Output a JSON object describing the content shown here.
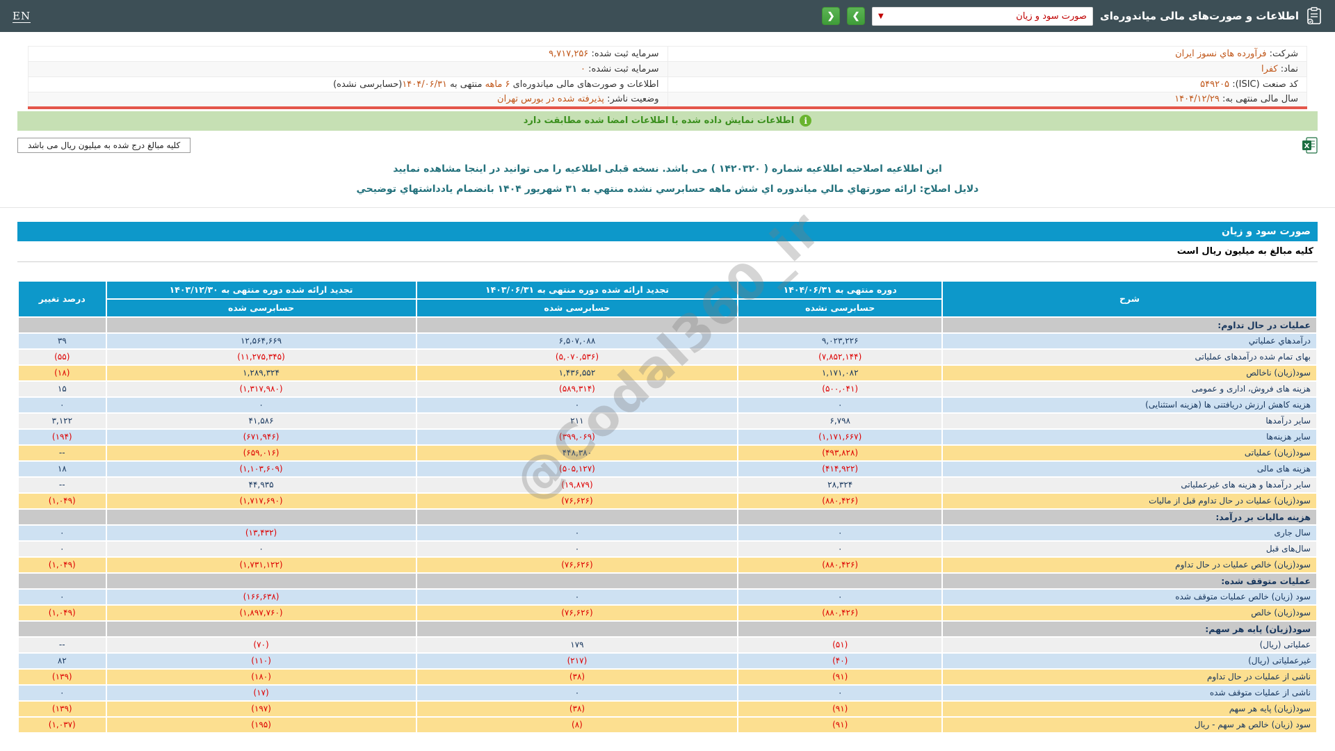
{
  "topbar": {
    "title": "اطلاعات و صورت‌های مالی میاندوره‌ای",
    "dropdown_value": "صورت سود و زیان",
    "dropdown_chevron": "▼",
    "next_label": "❯",
    "prev_label": "❮",
    "lang_link": "EN"
  },
  "company": {
    "name_label": "شرکت:",
    "name_value": "فرآورده هاي نسوز ايران",
    "cap_reg_label": "سرمایه ثبت شده:",
    "cap_reg_value": "۹,۷۱۷,۲۵۶",
    "symbol_label": "نماد:",
    "symbol_value": "کفرا",
    "cap_unreg_label": "سرمایه ثبت نشده:",
    "cap_unreg_value": "۰",
    "isic_label": "کد صنعت (ISIC):",
    "isic_value": "۵۴۹۲۰۵",
    "period_text1": "اطلاعات و صورت‌های مالی میاندوره‌ای ",
    "period_hl1": "۶ ماهه",
    "period_text2": " منتهی به ",
    "period_hl2": "۱۴۰۴/۰۶/۳۱",
    "period_text3": "(حسابرسی نشده)",
    "fiscal_label": "سال مالی منتهی به:",
    "fiscal_value": "۱۴۰۴/۱۲/۲۹",
    "status_label": "وضعیت ناشر:",
    "status_value": "پذیرفته شده در بورس تهران"
  },
  "banner": {
    "text": "اطلاعات نمایش داده شده با اطلاعات امضا شده مطابقت دارد",
    "icon_glyph": "i"
  },
  "units": {
    "boxed_note": "کلیه مبالغ درج شده به میلیون ریال می باشد",
    "table_note": "کلیه مبالغ به میلیون ریال است"
  },
  "notices": {
    "amendment": "این اطلاعیه اصلاحیه اطلاعیه شماره ( ۱۴۲۰۳۲۰ ) می باشد. نسخه قبلی اطلاعیه را می توانید در اینجا مشاهده نمایید",
    "reason": "دلایل اصلاح: ارائه صورتهاي مالي میاندوره اي شش ماهه حسابرسي نشده منتهي به ۳۱ شهریور ۱۴۰۴ بانضمام یادداشتهاي توضیحي"
  },
  "statement": {
    "title": "صورت سود و زیان"
  },
  "watermark": {
    "text": "@Codal360_ir"
  },
  "table": {
    "columns": [
      {
        "title": "شرح",
        "sub": null
      },
      {
        "title": "دوره منتهی به ۱۴۰۴/۰۶/۳۱",
        "sub": "حسابرسی نشده"
      },
      {
        "title": "تجدید ارائه شده دوره منتهی به ۱۴۰۳/۰۶/۳۱",
        "sub": "حسابرسی شده"
      },
      {
        "title": "تجدید ارائه شده دوره منتهی به ۱۴۰۳/۱۲/۳۰",
        "sub": "حسابرسی شده"
      },
      {
        "title": "درصد تغییر",
        "sub": null
      }
    ],
    "col_widths": [
      "28.9%",
      "15.7%",
      "24.8%",
      "23.9%",
      "6.7%"
    ],
    "rows": [
      {
        "type": "section",
        "label": "عملیات در حال تداوم:",
        "v1": "",
        "v2": "",
        "v3": "",
        "pct": ""
      },
      {
        "type": "blue",
        "label": "درآمدهاي عملياتي",
        "v1": "۹,۰۲۳,۲۲۶",
        "v2": "۶,۵۰۷,۰۸۸",
        "v3": "۱۲,۵۶۴,۶۶۹",
        "pct": "۳۹"
      },
      {
        "type": "gray",
        "label": "بهای تمام شده درآمدهای عملیاتی",
        "v1": "(۷,۸۵۲,۱۴۴)",
        "v2": "(۵,۰۷۰,۵۳۶)",
        "v3": "(۱۱,۲۷۵,۳۴۵)",
        "pct": "(۵۵)"
      },
      {
        "type": "yellow",
        "label": "سود(زیان) ناخالص",
        "v1": "۱,۱۷۱,۰۸۲",
        "v2": "۱,۴۳۶,۵۵۲",
        "v3": "۱,۲۸۹,۳۲۴",
        "pct": "(۱۸)"
      },
      {
        "type": "gray",
        "label": "هزینه های فروش، اداری و عمومی",
        "v1": "(۵۰۰,۰۴۱)",
        "v2": "(۵۸۹,۳۱۴)",
        "v3": "(۱,۳۱۷,۹۸۰)",
        "pct": "۱۵"
      },
      {
        "type": "blue",
        "label": "هزینه کاهش ارزش دریافتنی ها (هزینه استثنایی)",
        "v1": "۰",
        "v2": "۰",
        "v3": "۰",
        "pct": "۰"
      },
      {
        "type": "gray",
        "label": "سایر درآمدها",
        "v1": "۶,۷۹۸",
        "v2": "۲۱۱",
        "v3": "۴۱,۵۸۶",
        "pct": "۳,۱۲۲"
      },
      {
        "type": "blue",
        "label": "سایر هزینه‌ها",
        "v1": "(۱,۱۷۱,۶۶۷)",
        "v2": "(۳۹۹,۰۶۹)",
        "v3": "(۶۷۱,۹۴۶)",
        "pct": "(۱۹۴)"
      },
      {
        "type": "yellow",
        "label": "سود(زیان) عملیاتی",
        "v1": "(۴۹۳,۸۲۸)",
        "v2": "۴۴۸,۳۸۰",
        "v3": "(۶۵۹,۰۱۶)",
        "pct": "--"
      },
      {
        "type": "blue",
        "label": "هزینه های مالی",
        "v1": "(۴۱۴,۹۲۲)",
        "v2": "(۵۰۵,۱۲۷)",
        "v3": "(۱,۱۰۳,۶۰۹)",
        "pct": "۱۸"
      },
      {
        "type": "gray",
        "label": "سایر درآمدها و هزینه های غیرعملیاتی",
        "v1": "۲۸,۳۲۴",
        "v2": "(۱۹,۸۷۹)",
        "v3": "۴۴,۹۳۵",
        "pct": "--"
      },
      {
        "type": "yellow",
        "label": "سود(زیان) عملیات در حال تداوم قبل از مالیات",
        "v1": "(۸۸۰,۴۲۶)",
        "v2": "(۷۶,۶۲۶)",
        "v3": "(۱,۷۱۷,۶۹۰)",
        "pct": "(۱,۰۴۹)"
      },
      {
        "type": "section",
        "label": "هزینه مالیات بر درآمد:",
        "v1": "",
        "v2": "",
        "v3": "",
        "pct": ""
      },
      {
        "type": "blue",
        "label": "سال جاری",
        "v1": "۰",
        "v2": "۰",
        "v3": "(۱۳,۴۳۲)",
        "pct": "۰"
      },
      {
        "type": "gray",
        "label": "سال‌های قبل",
        "v1": "۰",
        "v2": "۰",
        "v3": "۰",
        "pct": "۰"
      },
      {
        "type": "yellow",
        "label": "سود(زیان) خالص عملیات در حال تداوم",
        "v1": "(۸۸۰,۴۲۶)",
        "v2": "(۷۶,۶۲۶)",
        "v3": "(۱,۷۳۱,۱۲۲)",
        "pct": "(۱,۰۴۹)"
      },
      {
        "type": "section",
        "label": "عملیات متوقف شده:",
        "v1": "",
        "v2": "",
        "v3": "",
        "pct": ""
      },
      {
        "type": "blue",
        "label": "سود (زیان) خالص عملیات متوقف شده",
        "v1": "۰",
        "v2": "۰",
        "v3": "(۱۶۶,۶۳۸)",
        "pct": "۰"
      },
      {
        "type": "yellow",
        "label": "سود(زیان) خالص",
        "v1": "(۸۸۰,۴۲۶)",
        "v2": "(۷۶,۶۲۶)",
        "v3": "(۱,۸۹۷,۷۶۰)",
        "pct": "(۱,۰۴۹)"
      },
      {
        "type": "section",
        "label": "سود(زیان) پایه هر سهم:",
        "v1": "",
        "v2": "",
        "v3": "",
        "pct": ""
      },
      {
        "type": "gray",
        "label": "عملیاتی (ریال)",
        "v1": "(۵۱)",
        "v2": "۱۷۹",
        "v3": "(۷۰)",
        "pct": "--"
      },
      {
        "type": "blue",
        "label": "غیرعملیاتی (ریال)",
        "v1": "(۴۰)",
        "v2": "(۲۱۷)",
        "v3": "(۱۱۰)",
        "pct": "۸۲"
      },
      {
        "type": "yellow",
        "label": "ناشی از عملیات در حال تداوم",
        "v1": "(۹۱)",
        "v2": "(۳۸)",
        "v3": "(۱۸۰)",
        "pct": "(۱۳۹)"
      },
      {
        "type": "blue",
        "label": "ناشی از عملیات متوقف شده",
        "v1": "۰",
        "v2": "۰",
        "v3": "(۱۷)",
        "pct": "۰"
      },
      {
        "type": "yellow",
        "label": "سود(زیان) پایه هر سهم",
        "v1": "(۹۱)",
        "v2": "(۳۸)",
        "v3": "(۱۹۷)",
        "pct": "(۱۳۹)"
      },
      {
        "type": "yellow",
        "label": "سود (زیان) خالص هر سهم - ریال",
        "v1": "(۹۱)",
        "v2": "(۸)",
        "v3": "(۱۹۵)",
        "pct": "(۱,۰۳۷)"
      }
    ]
  }
}
